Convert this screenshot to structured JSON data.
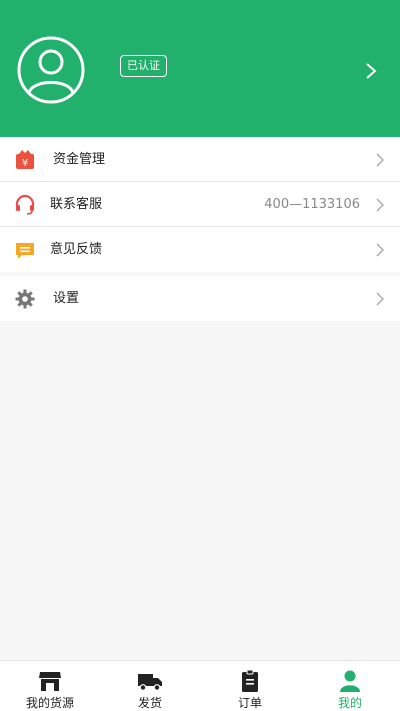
{
  "profile": {
    "verified_badge": "已认证"
  },
  "menu": {
    "funds": {
      "label": "资金管理",
      "icon": "yuan-wallet-icon"
    },
    "support": {
      "label": "联系客服",
      "value": "400—1133106",
      "icon": "headset-icon"
    },
    "feedback": {
      "label": "意见反馈",
      "icon": "message-icon"
    },
    "settings": {
      "label": "设置",
      "icon": "gear-icon"
    }
  },
  "tabbar": {
    "tabs": [
      {
        "label": "我的货源",
        "icon": "store-icon",
        "active": false
      },
      {
        "label": "发货",
        "icon": "truck-icon",
        "active": false
      },
      {
        "label": "订单",
        "icon": "clipboard-icon",
        "active": false
      },
      {
        "label": "我的",
        "icon": "user-icon",
        "active": true
      }
    ]
  },
  "colors": {
    "brand_green": "#22b16c",
    "funds_icon": "#e8523f",
    "support_icon": "#e94b4b",
    "feedback_icon": "#f5a623",
    "settings_icon": "#777777"
  }
}
